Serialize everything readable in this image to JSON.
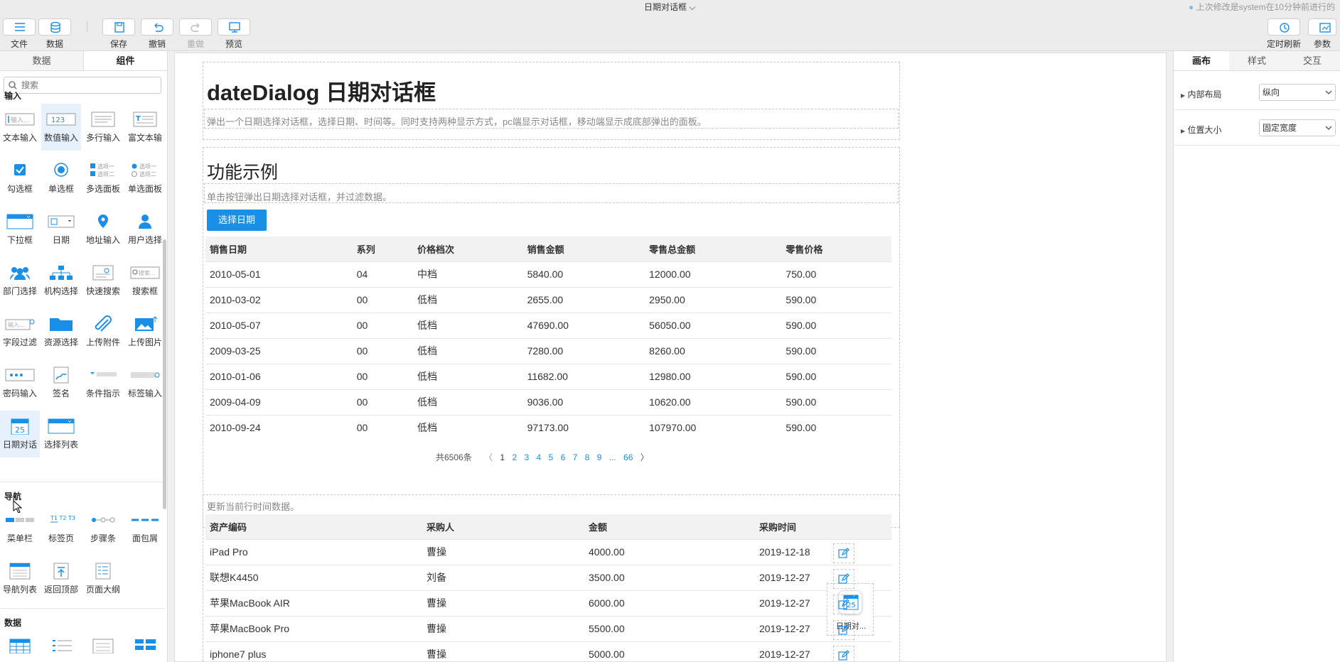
{
  "topbar": {
    "doc_title": "日期对话框",
    "last_modified": "上次修改是system在10分钟前进行的",
    "buttons": {
      "file": "文件",
      "data": "数据",
      "save": "保存",
      "undo": "撤销",
      "redo": "重做",
      "preview": "预览",
      "timed_refresh": "定时刷新",
      "params": "参数"
    }
  },
  "left_panel": {
    "tabs": [
      "数据",
      "组件"
    ],
    "search_placeholder": "搜索",
    "sections": {
      "input": "输入",
      "nav": "导航",
      "data": "数据"
    },
    "input_items": [
      "文本输入",
      "数值输入",
      "多行输入",
      "富文本输",
      "勾选框",
      "单选框",
      "多选面板",
      "单选面板",
      "下拉框",
      "日期",
      "地址输入",
      "用户选择",
      "部门选择",
      "机构选择",
      "快速搜索",
      "搜索框",
      "字段过滤",
      "资源选择",
      "上传附件",
      "上传图片",
      "密码输入",
      "签名",
      "条件指示",
      "标签输入",
      "日期对话",
      "选择列表"
    ],
    "nav_items": [
      "菜单栏",
      "标签页",
      "步骤条",
      "面包屑",
      "导航列表",
      "返回顶部",
      "页面大纲"
    ],
    "icon_text": {
      "text_input": "输入...",
      "number_input": "123",
      "opt1": "选项一",
      "opt2": "选项二",
      "search": "搜索...",
      "field_input": "输入..."
    }
  },
  "canvas": {
    "title": "dateDialog 日期对话框",
    "description": "弹出一个日期选择对话框，选择日期、时间等。同时支持两种显示方式，pc端显示对话框，移动端显示成底部弹出的面板。",
    "section_title": "功能示例",
    "section_desc": "单击按钮弹出日期选择对话框，并过滤数据。",
    "choose_button": "选择日期",
    "table1": {
      "headers": [
        "销售日期",
        "系列",
        "价格档次",
        "销售金额",
        "零售总金额",
        "零售价格"
      ],
      "rows": [
        [
          "2010-05-01",
          "04",
          "中档",
          "5840.00",
          "12000.00",
          "750.00"
        ],
        [
          "2010-03-02",
          "00",
          "低档",
          "2655.00",
          "2950.00",
          "590.00"
        ],
        [
          "2010-05-07",
          "00",
          "低档",
          "47690.00",
          "56050.00",
          "590.00"
        ],
        [
          "2009-03-25",
          "00",
          "低档",
          "7280.00",
          "8260.00",
          "590.00"
        ],
        [
          "2010-01-06",
          "00",
          "低档",
          "11682.00",
          "12980.00",
          "590.00"
        ],
        [
          "2009-04-09",
          "00",
          "低档",
          "9036.00",
          "10620.00",
          "590.00"
        ],
        [
          "2010-09-24",
          "00",
          "低档",
          "97173.00",
          "107970.00",
          "590.00"
        ]
      ]
    },
    "pager": {
      "total": "共6506条",
      "prev": "〈",
      "pages": [
        "1",
        "2",
        "3",
        "4",
        "5",
        "6",
        "7",
        "8",
        "9"
      ],
      "ellipsis": "...",
      "last": "66",
      "next": "〉"
    },
    "update_desc": "更新当前行时间数据。",
    "table2": {
      "headers": [
        "资产编码",
        "采购人",
        "金额",
        "采购时间"
      ],
      "rows": [
        [
          "iPad Pro",
          "曹操",
          "4000.00",
          "2019-12-18"
        ],
        [
          "联想K4450",
          "刘备",
          "3500.00",
          "2019-12-27"
        ],
        [
          "苹果MacBook AIR",
          "曹操",
          "6000.00",
          "2019-12-27"
        ],
        [
          "苹果MacBook Pro",
          "曹操",
          "5500.00",
          "2019-12-27"
        ],
        [
          "iphone7 plus",
          "曹操",
          "5000.00",
          "2019-12-27"
        ]
      ]
    },
    "drag_widget": {
      "label": "日期对...",
      "day": "25"
    }
  },
  "right_panel": {
    "tabs": [
      "画布",
      "样式",
      "交互"
    ],
    "props": [
      {
        "label": "内部布局",
        "value": "纵向"
      },
      {
        "label": "位置大小",
        "value": "固定宽度"
      }
    ]
  },
  "colors": {
    "accent": "#1a8fe8"
  }
}
